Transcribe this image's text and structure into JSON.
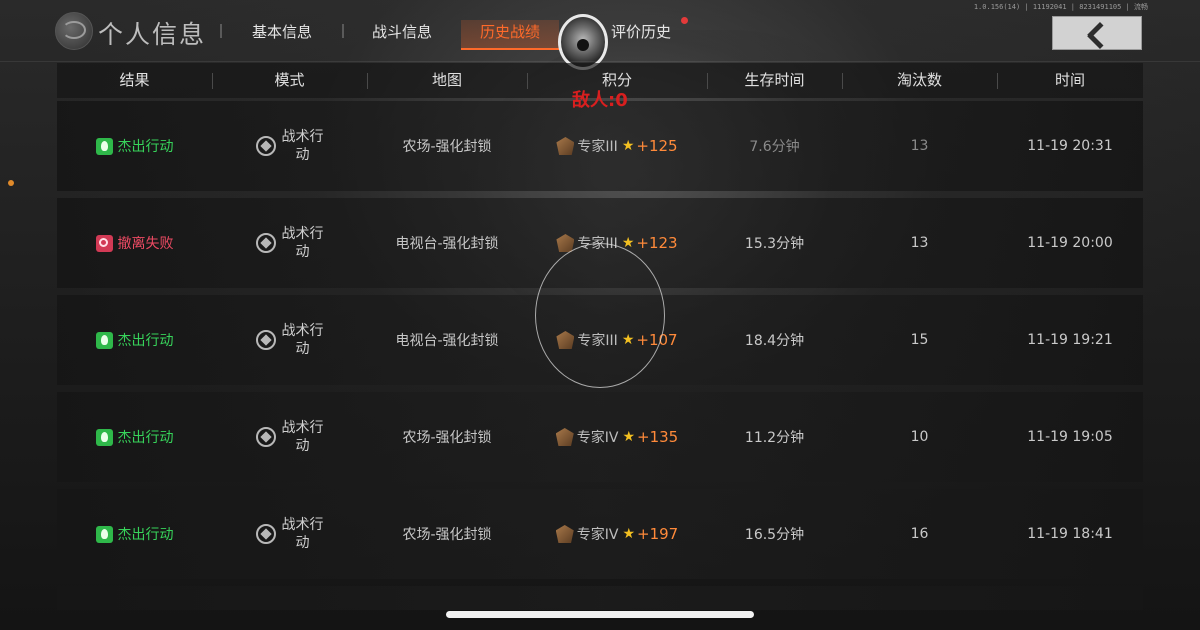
{
  "version": "1.0.156(14) | 11192041 | 8231491105 | 流畅",
  "header": {
    "title": "个人信息",
    "tabs": [
      {
        "label": "基本信息",
        "active": false
      },
      {
        "label": "战斗信息",
        "active": false
      },
      {
        "label": "历史战绩",
        "active": true
      },
      {
        "label": "评价历史",
        "active": false
      }
    ]
  },
  "table": {
    "columns": [
      "结果",
      "模式",
      "地图",
      "积分",
      "生存时间",
      "淘汰数",
      "时间"
    ],
    "enemy_label": "敌人:0",
    "rows": [
      {
        "result": "杰出行动",
        "result_type": "success",
        "mode": "战术行动",
        "map": "农场-强化封锁",
        "rank": "专家III",
        "score": "+125",
        "survival": "7.6分钟",
        "eliminations": "13",
        "time": "11-19 20:31"
      },
      {
        "result": "撤离失败",
        "result_type": "fail",
        "mode": "战术行动",
        "map": "电视台-强化封锁",
        "rank": "专家III",
        "score": "+123",
        "survival": "15.3分钟",
        "eliminations": "13",
        "time": "11-19 20:00"
      },
      {
        "result": "杰出行动",
        "result_type": "success",
        "mode": "战术行动",
        "map": "电视台-强化封锁",
        "rank": "专家III",
        "score": "+107",
        "survival": "18.4分钟",
        "eliminations": "15",
        "time": "11-19 19:21"
      },
      {
        "result": "杰出行动",
        "result_type": "success",
        "mode": "战术行动",
        "map": "农场-强化封锁",
        "rank": "专家IV",
        "score": "+135",
        "survival": "11.2分钟",
        "eliminations": "10",
        "time": "11-19 19:05"
      },
      {
        "result": "杰出行动",
        "result_type": "success",
        "mode": "战术行动",
        "map": "农场-强化封锁",
        "rank": "专家IV",
        "score": "+197",
        "survival": "16.5分钟",
        "eliminations": "16",
        "time": "11-19 18:41"
      }
    ]
  },
  "colors": {
    "accent": "#ff6a2a",
    "success": "#37d35a",
    "fail": "#ec4a63",
    "enemy": "#d81f1f"
  },
  "icons": {
    "title": "globe-icon",
    "back": "chevron-left-icon",
    "success": "flame-icon",
    "fail": "fail-icon",
    "mode": "tactical-mode-icon",
    "rank": "rank-badge-icon",
    "star": "star-icon"
  }
}
